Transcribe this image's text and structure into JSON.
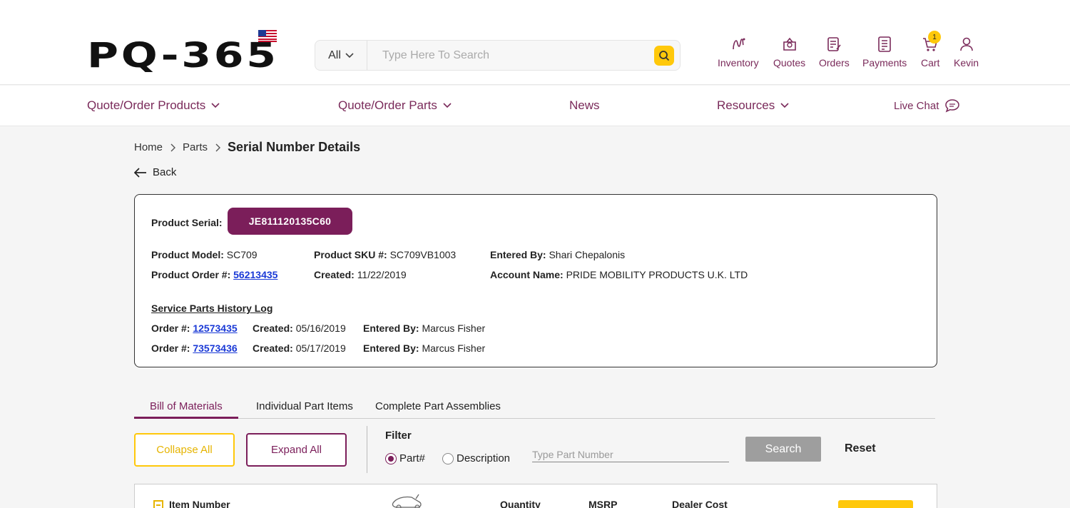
{
  "header": {
    "logo_text": "PQ-365",
    "search": {
      "category": "All",
      "placeholder": "Type Here To Search"
    },
    "nav_icons": [
      {
        "label": "Inventory",
        "icon": "inventory-icon"
      },
      {
        "label": "Quotes",
        "icon": "quotes-icon"
      },
      {
        "label": "Orders",
        "icon": "orders-icon"
      },
      {
        "label": "Payments",
        "icon": "payments-icon"
      },
      {
        "label": "Cart",
        "icon": "cart-icon",
        "badge": "1"
      },
      {
        "label": "Kevin",
        "icon": "user-icon"
      }
    ]
  },
  "menu": {
    "items": [
      {
        "label": "Quote/Order Products"
      },
      {
        "label": "Quote/Order Parts"
      },
      {
        "label": "News"
      },
      {
        "label": "Resources"
      },
      {
        "label": "Live Chat"
      }
    ]
  },
  "breadcrumb": {
    "home": "Home",
    "parts": "Parts",
    "current": "Serial Number Details"
  },
  "back_label": "Back",
  "product": {
    "serial_label": "Product Serial:",
    "serial": "JE811120135C60",
    "model_label": "Product Model:",
    "model": "SC709",
    "sku_label": "Product SKU #:",
    "sku": "SC709VB1003",
    "entered_label": "Entered By:",
    "entered_by": "Shari Chepalonis",
    "order_label": "Product Order #:",
    "order": "56213435",
    "created_label": "Created:",
    "created": "11/22/2019",
    "account_label": "Account Name:",
    "account": "PRIDE MOBILITY PRODUCTS U.K. LTD"
  },
  "history": {
    "title": "Service Parts History Log",
    "order_label": "Order #:",
    "created_label": "Created:",
    "entered_label": "Entered By:",
    "entries": [
      {
        "order": "12573435",
        "created": "05/16/2019",
        "entered_by": "Marcus Fisher"
      },
      {
        "order": "73573436",
        "created": "05/17/2019",
        "entered_by": "Marcus Fisher"
      }
    ]
  },
  "tabs": [
    {
      "label": "Bill of Materials",
      "active": true
    },
    {
      "label": "Individual Part Items",
      "active": false
    },
    {
      "label": "Complete Part Assemblies",
      "active": false
    }
  ],
  "controls": {
    "collapse_all": "Collapse All",
    "expand_all": "Expand All",
    "filter_label": "Filter",
    "radio_part": "Part#",
    "radio_description": "Description",
    "part_placeholder": "Type Part Number",
    "search": "Search",
    "reset": "Reset"
  },
  "table": {
    "columns": {
      "item_number": "Item Number",
      "quantity": "Quantity",
      "msrp": "MSRP",
      "dealer_cost": "Dealer Cost"
    }
  },
  "colors": {
    "brand": "#7b1e5a",
    "accent": "#ffc80a",
    "link": "#1a39d6"
  }
}
